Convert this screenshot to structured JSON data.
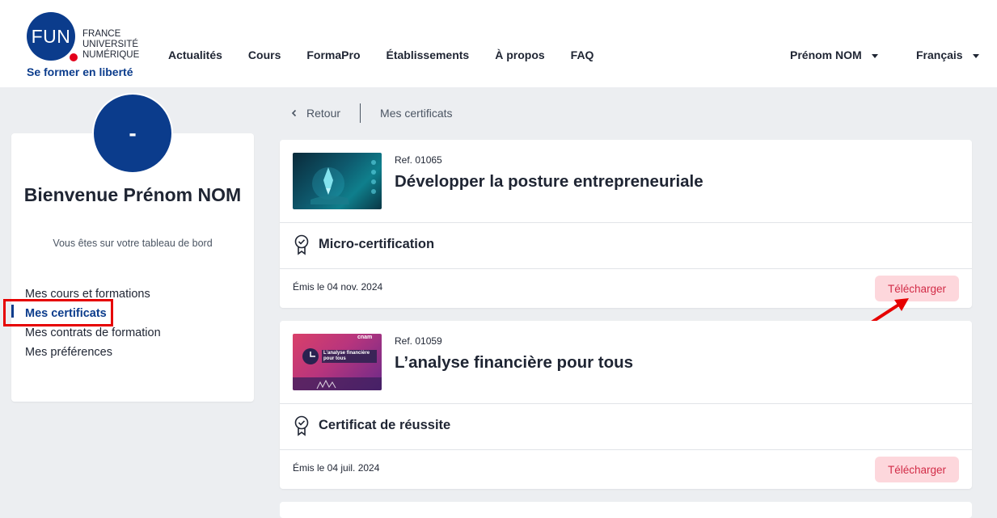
{
  "header": {
    "logo_text": "FUN",
    "logo_line1": "FRANCE",
    "logo_line2": "UNIVERSITÉ",
    "logo_line3": "NUMÉRIQUE",
    "tagline": "Se former en liberté",
    "nav": [
      "Actualités",
      "Cours",
      "FormaPro",
      "Établissements",
      "À propos",
      "FAQ"
    ],
    "user": "Prénom NOM",
    "language": "Français"
  },
  "sidebar": {
    "avatar_text": "-",
    "welcome": "Bienvenue Prénom NOM",
    "subtitle": "Vous êtes sur votre tableau de bord",
    "menu": [
      "Mes cours et formations",
      "Mes certificats",
      "Mes contrats de formation",
      "Mes préférences"
    ]
  },
  "breadcrumb": {
    "back": "Retour",
    "current": "Mes certificats"
  },
  "certificates": [
    {
      "ref": "Ref. 01065",
      "title": "Développer la posture entrepreneuriale",
      "type": "Micro-certification",
      "issued": "Émis le 04 nov. 2024",
      "download": "Télécharger"
    },
    {
      "ref": "Ref. 01059",
      "title": "L’analyse financière pour tous",
      "type": "Certificat de réussite",
      "issued": "Émis le 04 juil. 2024",
      "download": "Télécharger",
      "thumb_badge": "cnam",
      "thumb_title": "L’analyse financière pour tous"
    }
  ],
  "colors": {
    "brand": "#0b3c8c",
    "logo_dot": "#e3001b",
    "download_bg": "#fdd7dc",
    "download_text": "#d22c47",
    "annotation": "#e60000"
  }
}
